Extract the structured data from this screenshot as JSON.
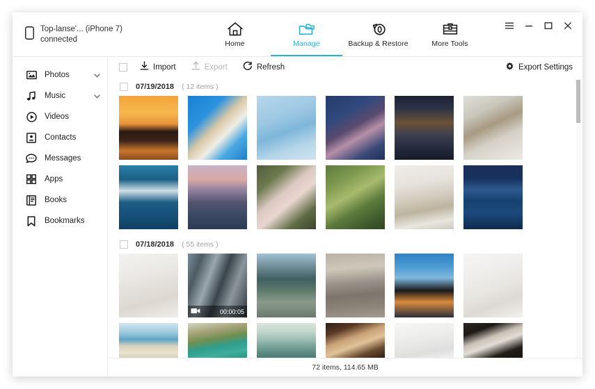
{
  "window": {
    "controls": [
      {
        "name": "menu-button",
        "glyph": "≡"
      },
      {
        "name": "minimize-button",
        "glyph": "–"
      },
      {
        "name": "maximize-button",
        "glyph": "□"
      },
      {
        "name": "close-button",
        "glyph": "✕"
      }
    ]
  },
  "device": {
    "name": "Top-lanse'... (iPhone 7)",
    "status": "connected",
    "icon": "phone-icon"
  },
  "nav": {
    "tabs": [
      {
        "label": "Home",
        "icon": "home-icon",
        "active": false
      },
      {
        "label": "Manage",
        "icon": "folder-icon",
        "active": true
      },
      {
        "label": "Backup & Restore",
        "icon": "restore-icon",
        "active": false
      },
      {
        "label": "More Tools",
        "icon": "toolbox-icon",
        "active": false
      }
    ],
    "accent_color": "#2bb3d4"
  },
  "sidebar": {
    "items": [
      {
        "label": "Photos",
        "icon": "photos-icon",
        "expandable": true
      },
      {
        "label": "Music",
        "icon": "music-icon",
        "expandable": true
      },
      {
        "label": "Videos",
        "icon": "videos-icon",
        "expandable": false
      },
      {
        "label": "Contacts",
        "icon": "contacts-icon",
        "expandable": false
      },
      {
        "label": "Messages",
        "icon": "messages-icon",
        "expandable": false
      },
      {
        "label": "Apps",
        "icon": "apps-icon",
        "expandable": false
      },
      {
        "label": "Books",
        "icon": "books-icon",
        "expandable": false
      },
      {
        "label": "Bookmarks",
        "icon": "bookmarks-icon",
        "expandable": false
      }
    ]
  },
  "toolbar": {
    "select_all_checked": false,
    "import_label": "Import",
    "export_label": "Export",
    "export_disabled": true,
    "refresh_label": "Refresh",
    "export_settings_label": "Export Settings"
  },
  "groups": [
    {
      "date": "07/19/2018",
      "count": "( 12 items )",
      "checked": false,
      "rows": [
        [
          {
            "name": "photo-sunset-beach",
            "art": "p-sunset"
          },
          {
            "name": "photo-poolside-hat",
            "art": "p-pool"
          },
          {
            "name": "photo-pool-swimmer",
            "art": "p-pool2"
          },
          {
            "name": "photo-cherry-blossom",
            "art": "p-blossom"
          },
          {
            "name": "photo-lantern-alley",
            "art": "p-alley"
          },
          {
            "name": "photo-deer",
            "art": "p-deer"
          }
        ],
        [
          {
            "name": "photo-beluga-whale",
            "art": "p-beluga"
          },
          {
            "name": "photo-dusk-mountain",
            "art": "p-dusk"
          },
          {
            "name": "photo-flower",
            "art": "p-flower"
          },
          {
            "name": "photo-rice-terrace",
            "art": "p-rice"
          },
          {
            "name": "photo-washing-hands",
            "art": "p-wash"
          },
          {
            "name": "photo-ocean-waves",
            "art": "p-wave"
          }
        ]
      ]
    },
    {
      "date": "07/18/2018",
      "count": "( 55 items )",
      "checked": false,
      "rows": [
        [
          {
            "name": "photo-living-room",
            "art": "p-livingrm"
          },
          {
            "name": "video-city-building",
            "art": "p-building",
            "duration": "00:00:05"
          },
          {
            "name": "photo-coast-sitting",
            "art": "p-coast"
          },
          {
            "name": "photo-st-peters",
            "art": "p-square"
          },
          {
            "name": "photo-jumping",
            "art": "p-jump"
          },
          {
            "name": "photo-white-shirt",
            "art": "p-shirt"
          }
        ],
        [
          {
            "name": "photo-beach-crowd",
            "art": "p-beach",
            "short": true
          },
          {
            "name": "photo-limestone-bay",
            "art": "p-cliff",
            "short": true
          },
          {
            "name": "photo-sunset-sea",
            "art": "p-sunsea",
            "short": true
          },
          {
            "name": "photo-family",
            "art": "p-family",
            "short": true
          },
          {
            "name": "photo-pendant-lamp",
            "art": "p-lamp",
            "short": true
          },
          {
            "name": "photo-cat",
            "art": "p-cat",
            "short": true
          }
        ]
      ]
    }
  ],
  "status": {
    "summary": "72 items, 114.65 MB"
  }
}
